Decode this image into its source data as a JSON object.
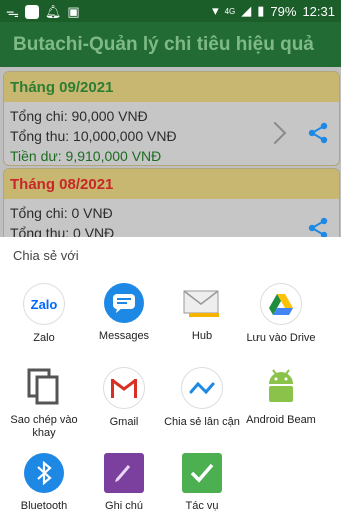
{
  "status": {
    "battery": "79%",
    "time": "12:31",
    "network": "4G"
  },
  "appbar": {
    "title": "Butachi-Quản lý chi tiêu hiệu quả"
  },
  "months": [
    {
      "title": "Tháng 09/2021",
      "title_color": "#2e7d32",
      "spent": "Tổng chi: 90,000 VNĐ",
      "income": "Tổng thu: 10,000,000 VNĐ",
      "remaining": "Tiền dư: 9,910,000 VNĐ"
    },
    {
      "title": "Tháng 08/2021",
      "title_color": "#c62828",
      "spent": "Tổng chi: 0 VNĐ",
      "income": "Tổng thu: 0 VNĐ"
    }
  ],
  "share_sheet": {
    "title": "Chia sẻ với",
    "apps": [
      {
        "label": "Zalo",
        "icon": "zalo-icon"
      },
      {
        "label": "Messages",
        "icon": "messages-icon"
      },
      {
        "label": "Hub",
        "icon": "mail-icon"
      },
      {
        "label": "Lưu vào Drive",
        "icon": "drive-icon"
      },
      {
        "label": "Sao chép vào khay",
        "icon": "copy-icon"
      },
      {
        "label": "Gmail",
        "icon": "gmail-icon"
      },
      {
        "label": "Chia sẻ lân cận",
        "icon": "nearby-share-icon"
      },
      {
        "label": "Android Beam",
        "icon": "android-icon"
      },
      {
        "label": "Bluetooth",
        "icon": "bluetooth-icon"
      },
      {
        "label": "Ghi chú",
        "icon": "note-icon"
      },
      {
        "label": "Tác vụ",
        "icon": "task-icon"
      }
    ]
  },
  "colors": {
    "status_bar": "#1b5e2a",
    "app_bar": "#226b34",
    "accent": "#1e88e5"
  }
}
